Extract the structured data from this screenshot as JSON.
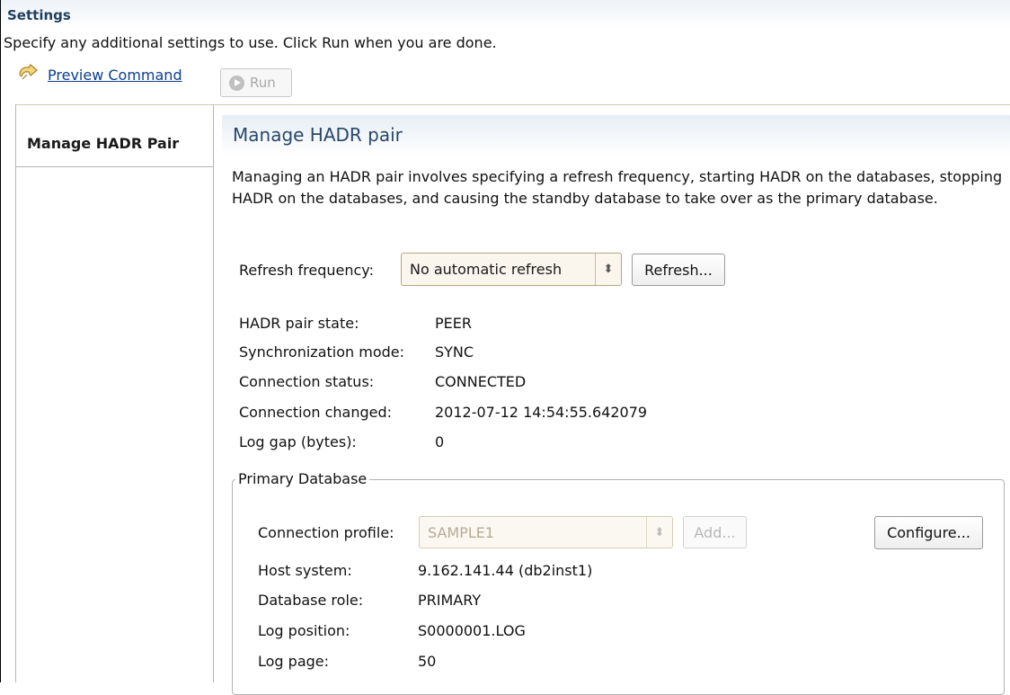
{
  "settings": {
    "title": "Settings",
    "instructions": "Specify any additional settings to use. Click Run when you are done.",
    "preview_label": "Preview Command",
    "run_label": "Run"
  },
  "nav": {
    "tab_label": "Manage HADR Pair"
  },
  "section": {
    "title": "Manage HADR pair",
    "description": "Managing an HADR pair involves specifying a refresh frequency, starting HADR on the databases, stopping HADR on the databases, and causing the standby database to take over as the primary database."
  },
  "refresh": {
    "label": "Refresh frequency:",
    "value": "No automatic refresh",
    "button_label": "Refresh..."
  },
  "status": {
    "pair_state_label": "HADR pair state:",
    "pair_state_value": "PEER",
    "sync_mode_label": "Synchronization mode:",
    "sync_mode_value": "SYNC",
    "conn_status_label": "Connection status:",
    "conn_status_value": "CONNECTED",
    "conn_changed_label": "Connection changed:",
    "conn_changed_value": "2012-07-12 14:54:55.642079",
    "log_gap_label": "Log gap (bytes):",
    "log_gap_value": "0"
  },
  "primary": {
    "legend": "Primary Database",
    "profile_label": "Connection profile:",
    "profile_value": "SAMPLE1",
    "add_label": "Add...",
    "configure_label": "Configure...",
    "host_label": "Host system:",
    "host_value": "9.162.141.44 (db2inst1)",
    "role_label": "Database role:",
    "role_value": "PRIMARY",
    "log_pos_label": "Log position:",
    "log_pos_value": "S0000001.LOG",
    "log_page_label": "Log page:",
    "log_page_value": "50"
  },
  "icons": {
    "preview": "preview-command-icon",
    "run": "run-icon",
    "spinner": "up-down-arrows-icon"
  },
  "colors": {
    "section_title": "#29476b",
    "link": "#0a3f8c",
    "combo_border": "#b9a77c"
  }
}
